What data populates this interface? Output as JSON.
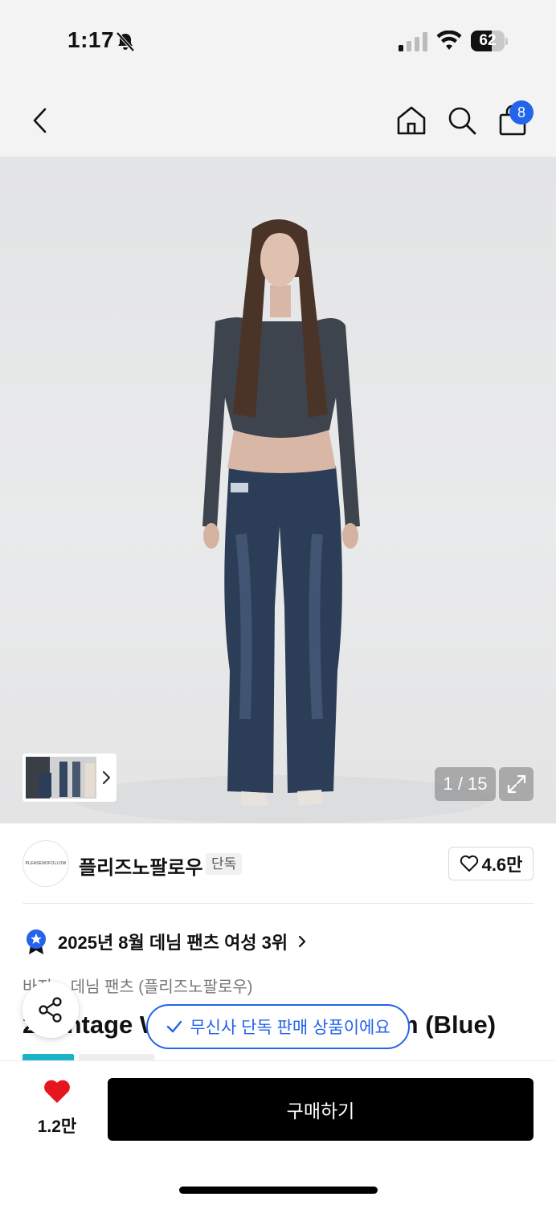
{
  "status_bar": {
    "time": "1:17",
    "battery": "62",
    "battery_level": 0.62
  },
  "nav": {
    "back_icon": "chevron-left-icon",
    "home_icon": "home-icon",
    "search_icon": "search-icon",
    "cart_icon": "shopping-bag-icon",
    "cart_count": "8"
  },
  "gallery": {
    "counter": "1 / 15",
    "expand_icon": "expand-icon"
  },
  "brand": {
    "logo_text": "PLEASENOFOLLOW",
    "name": "플리즈노팔로우",
    "tag": "단독",
    "likes": "4.6만"
  },
  "ranking": {
    "text": "2025년 8월 데님 팬츠 여성 3위"
  },
  "product": {
    "breadcrumb": "바지 > 데님 팬츠 (플리즈노팔로우)",
    "title": "2 Vintage Washed Bootcut Denim (Blue)"
  },
  "overlay": {
    "exclusive_notice": "무신사 단독 판매 상품이에요"
  },
  "bottom_bar": {
    "wish_count": "1.2만",
    "buy_label": "구매하기"
  },
  "colors": {
    "accent_blue": "#2463eb",
    "heart_red": "#e5161d",
    "buy_black": "#000000"
  }
}
